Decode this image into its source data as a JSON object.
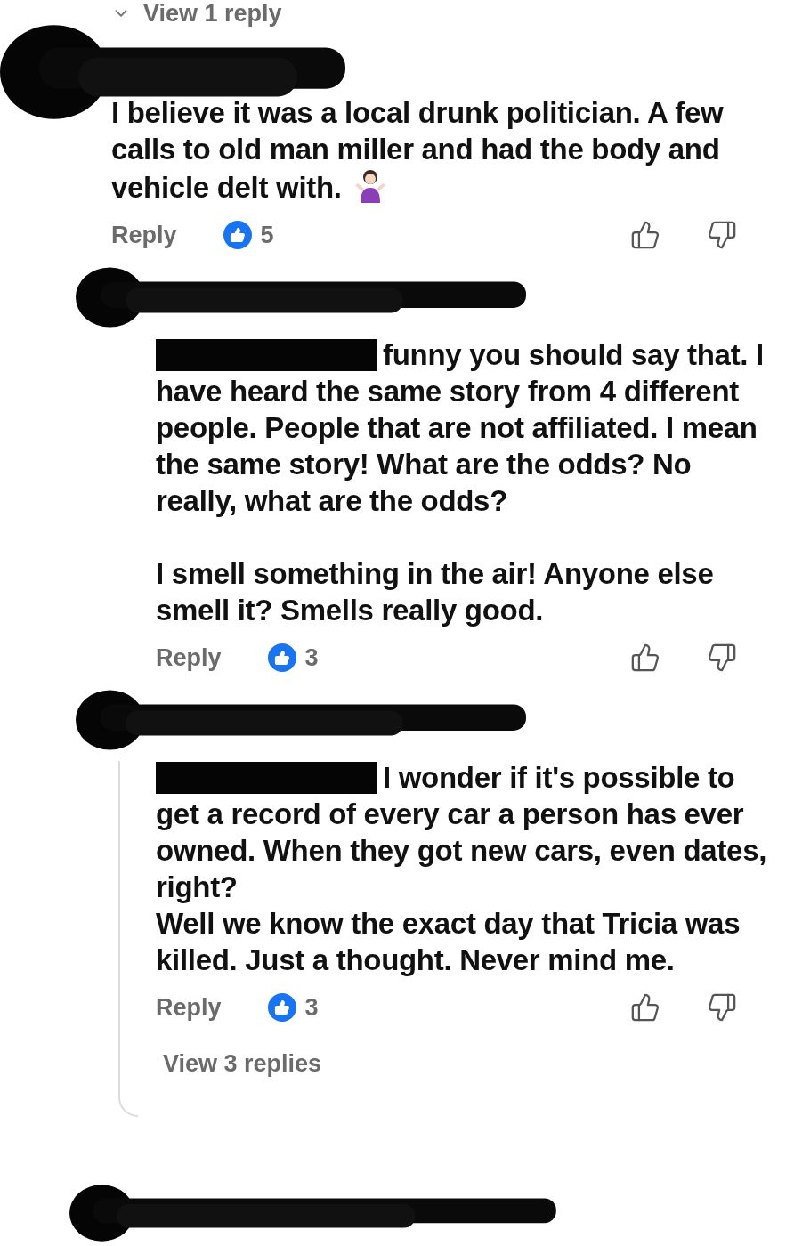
{
  "thread_toggle": {
    "label": "View 1 reply"
  },
  "comments": [
    {
      "text": "I believe it was a local drunk politician. A few calls to old man miller and had the body and vehicle delt with.",
      "reply_label": "Reply",
      "likes": "5",
      "children": [
        {
          "text": "funny you should say that. I have heard the same story from 4 different people. People that are not affiliated. I mean the same story! What are the odds? No really, what are the odds?\n\nI smell something in the air! Anyone else smell it? Smells really good.",
          "reply_label": "Reply",
          "likes": "3"
        },
        {
          "text": "I wonder if it's possible to get a record of every car a person has ever owned. When they got new cars, even dates, right?\nWell we know the exact day that Tricia was killed. Just a thought. Never mind me.",
          "reply_label": "Reply",
          "likes": "3",
          "view_replies": "View 3 replies"
        }
      ]
    }
  ]
}
